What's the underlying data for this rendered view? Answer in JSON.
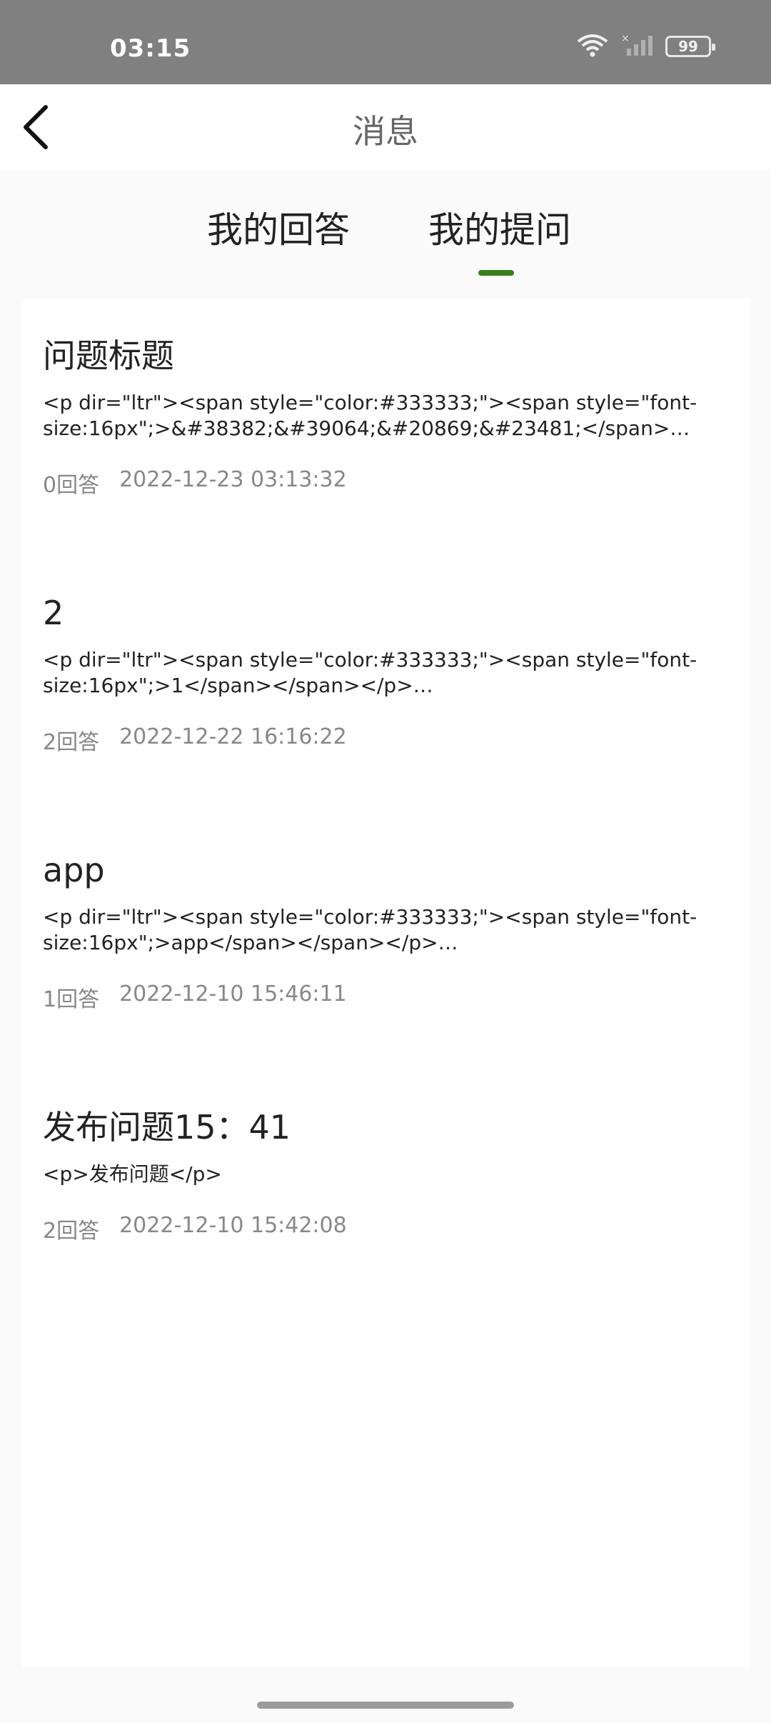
{
  "status": {
    "time": "03:15",
    "battery": "99"
  },
  "header": {
    "title": "消息"
  },
  "tabs": [
    {
      "label": "我的回答"
    },
    {
      "label": "我的提问"
    }
  ],
  "questions": [
    {
      "title": "问题标题",
      "body": "<p dir=\"ltr\"><span style=\"color:#333333;\"><span style=\"font-size:16px\";>&#38382;&#39064;&#20869;&#23481;</span>…",
      "answers": "0回答",
      "time": "2022-12-23 03:13:32"
    },
    {
      "title": "2",
      "body": "<p dir=\"ltr\"><span style=\"color:#333333;\"><span style=\"font-size:16px\";>1</span></span></p>…",
      "answers": "2回答",
      "time": "2022-12-22 16:16:22"
    },
    {
      "title": "app",
      "body": "<p dir=\"ltr\"><span style=\"color:#333333;\"><span style=\"font-size:16px\";>app</span></span></p>…",
      "answers": "1回答",
      "time": "2022-12-10 15:46:11"
    },
    {
      "title": "发布问题15：41",
      "body": "<p>发布问题</p>",
      "answers": "2回答",
      "time": "2022-12-10 15:42:08"
    }
  ],
  "colors": {
    "accent": "#3a7d1f",
    "statusbar": "#808080"
  }
}
